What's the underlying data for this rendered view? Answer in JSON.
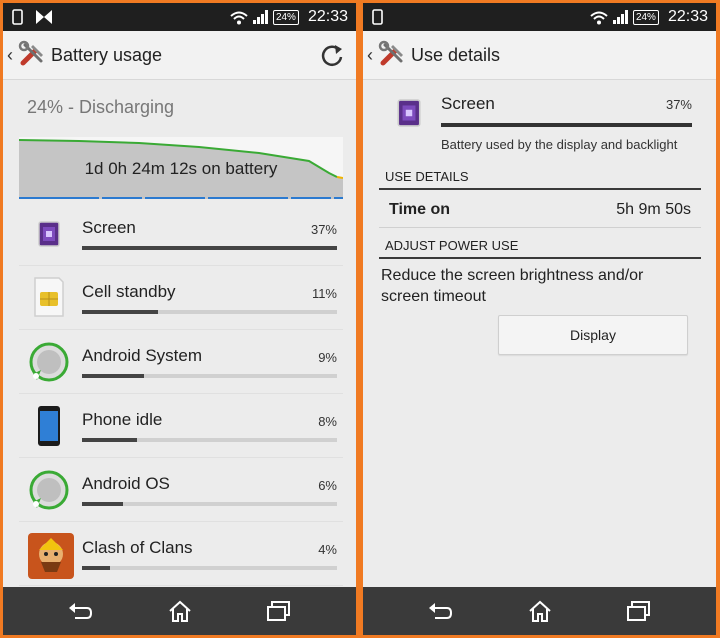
{
  "status_bar": {
    "time": "22:33",
    "battery_level": "24%"
  },
  "battery_usage": {
    "title": "Battery usage",
    "status": "24% - Discharging",
    "graph_label": "1d 0h 24m 12s on battery",
    "items": [
      {
        "name": "Screen",
        "percent": "37%",
        "fraction": 0.37,
        "icon": "screen-icon"
      },
      {
        "name": "Cell standby",
        "percent": "11%",
        "fraction": 0.11,
        "icon": "sim-card-icon"
      },
      {
        "name": "Android System",
        "percent": "9%",
        "fraction": 0.09,
        "icon": "android-system-icon"
      },
      {
        "name": "Phone idle",
        "percent": "8%",
        "fraction": 0.08,
        "icon": "phone-icon"
      },
      {
        "name": "Android OS",
        "percent": "6%",
        "fraction": 0.06,
        "icon": "android-os-icon"
      },
      {
        "name": "Clash of Clans",
        "percent": "4%",
        "fraction": 0.04,
        "icon": "clash-of-clans-icon"
      }
    ]
  },
  "use_details": {
    "title": "Use details",
    "app_name": "Screen",
    "percent": "37%",
    "fraction": 0.37,
    "description": "Battery used by the display and backlight",
    "section_details": "USE DETAILS",
    "time_on_label": "Time on",
    "time_on_value": "5h 9m 50s",
    "section_adjust": "ADJUST POWER USE",
    "adjust_text": "Reduce the screen brightness and/or screen timeout",
    "display_button": "Display"
  },
  "colors": {
    "accent": "#f07a22",
    "graph_line": "#3aaa35",
    "navbar": "#3a3a3a"
  }
}
